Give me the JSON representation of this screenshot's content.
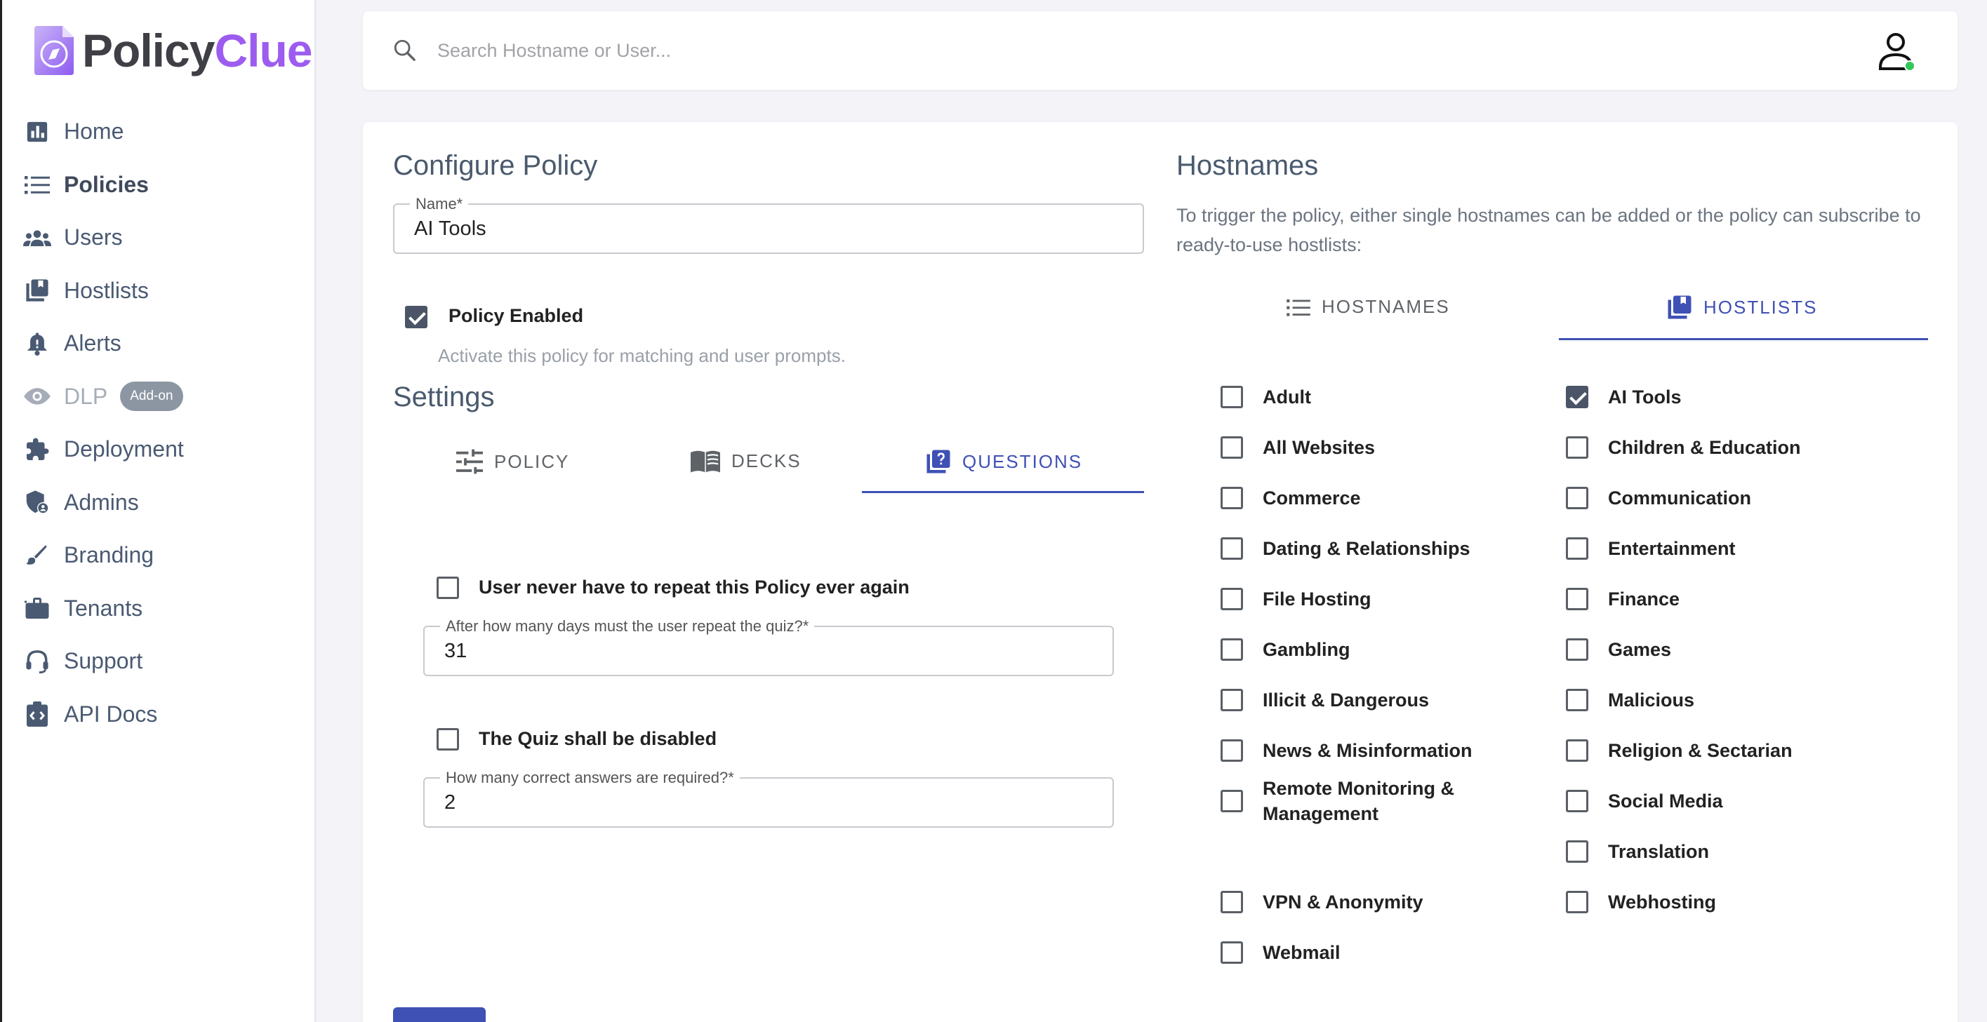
{
  "brand": {
    "name_part1": "Policy",
    "name_part2": "Clue"
  },
  "sidebar": {
    "items": [
      {
        "label": "Home",
        "icon": "chart-icon"
      },
      {
        "label": "Policies",
        "icon": "list-icon"
      },
      {
        "label": "Users",
        "icon": "users-icon"
      },
      {
        "label": "Hostlists",
        "icon": "library-icon"
      },
      {
        "label": "Alerts",
        "icon": "bell-icon"
      },
      {
        "label": "DLP",
        "icon": "eye-icon",
        "badge": "Add-on"
      },
      {
        "label": "Deployment",
        "icon": "puzzle-icon"
      },
      {
        "label": "Admins",
        "icon": "shield-user-icon"
      },
      {
        "label": "Branding",
        "icon": "brush-icon"
      },
      {
        "label": "Tenants",
        "icon": "briefcase-icon"
      },
      {
        "label": "Support",
        "icon": "headset-icon"
      },
      {
        "label": "API Docs",
        "icon": "code-clipboard-icon"
      }
    ]
  },
  "search": {
    "placeholder": "Search Hostname or User..."
  },
  "policy": {
    "title": "Configure Policy",
    "name_label": "Name*",
    "name_value": "AI Tools",
    "enabled_label": "Policy Enabled",
    "enabled": true,
    "enabled_hint": "Activate this policy for matching and user prompts."
  },
  "settings": {
    "title": "Settings",
    "tabs": [
      {
        "label": "POLICY",
        "icon": "tune-icon"
      },
      {
        "label": "DECKS",
        "icon": "book-icon"
      },
      {
        "label": "QUESTIONS",
        "icon": "question-library-icon",
        "active": true
      }
    ],
    "never_repeat_label": "User never have to repeat this Policy ever again",
    "never_repeat": false,
    "repeat_days_label": "After how many days must the user repeat the quiz?*",
    "repeat_days_value": "31",
    "quiz_disabled_label": "The Quiz shall be disabled",
    "quiz_disabled": false,
    "correct_answers_label": "How many correct answers are required?*",
    "correct_answers_value": "2"
  },
  "hostnames": {
    "title": "Hostnames",
    "description": "To trigger the policy, either single hostnames can be added or the policy can subscribe to ready-to-use hostlists:",
    "tabs": [
      {
        "label": "HOSTNAMES",
        "icon": "list-icon"
      },
      {
        "label": "HOSTLISTS",
        "icon": "library-icon",
        "active": true
      }
    ],
    "lists_left": [
      {
        "label": "Adult",
        "checked": false
      },
      {
        "label": "All Websites",
        "checked": false
      },
      {
        "label": "Commerce",
        "checked": false
      },
      {
        "label": "Dating & Relationships",
        "checked": false
      },
      {
        "label": "File Hosting",
        "checked": false
      },
      {
        "label": "Gambling",
        "checked": false
      },
      {
        "label": "Illicit & Dangerous",
        "checked": false
      },
      {
        "label": "News & Misinformation",
        "checked": false
      },
      {
        "label": "Remote Monitoring & Management",
        "checked": false
      },
      {
        "label": "VPN & Anonymity",
        "checked": false
      },
      {
        "label": "Webmail",
        "checked": false
      }
    ],
    "lists_right": [
      {
        "label": "AI Tools",
        "checked": true
      },
      {
        "label": "Children & Education",
        "checked": false
      },
      {
        "label": "Communication",
        "checked": false
      },
      {
        "label": "Entertainment",
        "checked": false
      },
      {
        "label": "Finance",
        "checked": false
      },
      {
        "label": "Games",
        "checked": false
      },
      {
        "label": "Malicious",
        "checked": false
      },
      {
        "label": "Religion & Sectarian",
        "checked": false
      },
      {
        "label": "Social Media",
        "checked": false
      },
      {
        "label": "Translation",
        "checked": false
      },
      {
        "label": "Webhosting",
        "checked": false
      }
    ]
  },
  "colors": {
    "accent": "#3f51b5",
    "brand_purple": "#9c5cf0",
    "checkbox_checked": "#4b5567"
  }
}
